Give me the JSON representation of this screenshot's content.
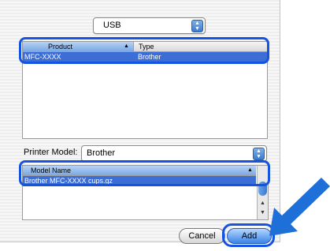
{
  "connection": {
    "selected": "USB"
  },
  "printer_list": {
    "columns": [
      "Product",
      "Type"
    ],
    "rows": [
      {
        "product": "MFC-XXXX",
        "type": "Brother"
      }
    ]
  },
  "printer_model": {
    "label": "Printer Model:",
    "selected": "Brother"
  },
  "model_list": {
    "column": "Model Name",
    "rows": [
      "Brother  MFC-XXXX cups.gz"
    ]
  },
  "buttons": {
    "cancel": "Cancel",
    "add": "Add"
  },
  "colors": {
    "highlight": "#1554e0",
    "selection": "#3d6ed6",
    "arrow": "#1f6fd8"
  }
}
